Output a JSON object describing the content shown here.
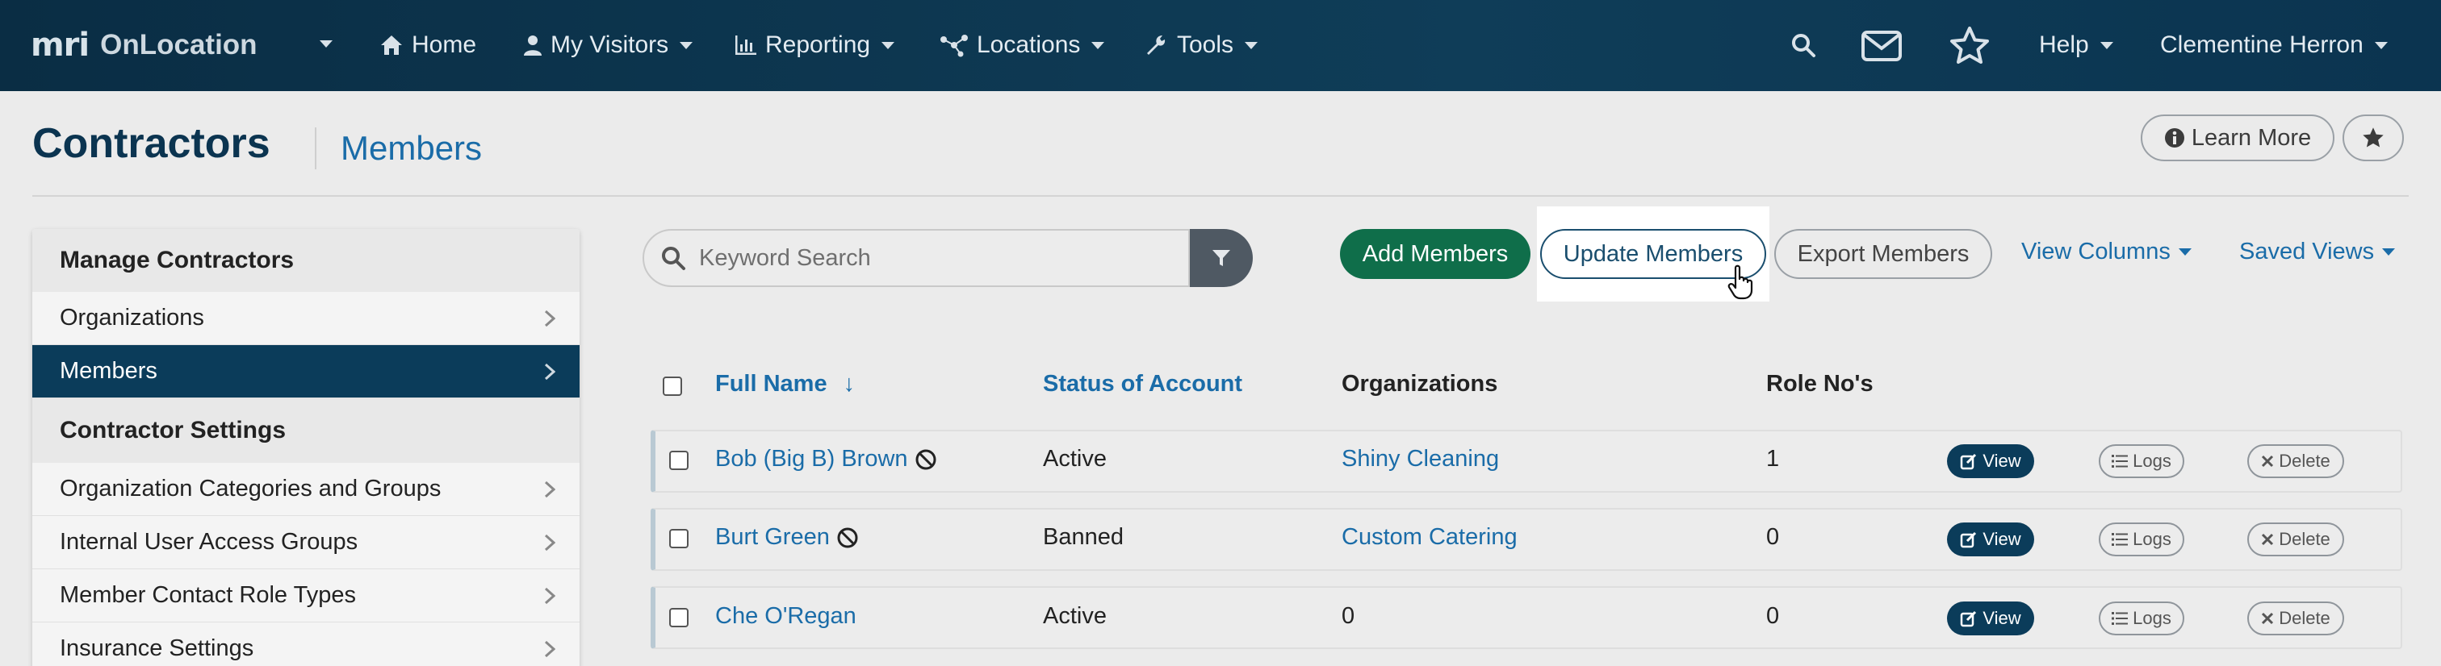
{
  "nav": {
    "brand_mark": "mri",
    "brand_app": "OnLocation",
    "home": "Home",
    "visitors": "My Visitors",
    "reporting": "Reporting",
    "locations": "Locations",
    "tools": "Tools",
    "help": "Help",
    "user": "Clementine Herron"
  },
  "header": {
    "title": "Contractors",
    "subtitle": "Members",
    "learn_more": "Learn More"
  },
  "sidebar": {
    "section1": "Manage Contractors",
    "items1": [
      {
        "label": "Organizations"
      },
      {
        "label": "Members",
        "active": true
      }
    ],
    "section2": "Contractor Settings",
    "items2": [
      {
        "label": "Organization Categories and Groups"
      },
      {
        "label": "Internal User Access Groups"
      },
      {
        "label": "Member Contact Role Types"
      },
      {
        "label": "Insurance Settings"
      }
    ]
  },
  "toolbar": {
    "search_placeholder": "Keyword Search",
    "add": "Add Members",
    "update": "Update Members",
    "export": "Export Members",
    "view_columns": "View Columns",
    "saved_views": "Saved Views"
  },
  "table": {
    "columns": {
      "full_name": "Full Name",
      "sort_arrow": "↓",
      "status": "Status of Account",
      "organizations": "Organizations",
      "roles": "Role No's"
    },
    "actions": {
      "view": "View",
      "logs": "Logs",
      "delete": "Delete"
    },
    "rows": [
      {
        "name": "Bob (Big B) Brown",
        "banned_icon": true,
        "status": "Active",
        "organization": "Shiny Cleaning",
        "org_is_link": true,
        "roles": "1"
      },
      {
        "name": "Burt Green",
        "banned_icon": true,
        "status": "Banned",
        "organization": "Custom Catering",
        "org_is_link": true,
        "roles": "0"
      },
      {
        "name": "Che O'Regan",
        "banned_icon": false,
        "status": "Active",
        "organization": "0",
        "org_is_link": false,
        "roles": "0"
      }
    ]
  },
  "colors": {
    "nav_bg": "#0b3450",
    "primary_dark": "#0b3c5a",
    "link": "#1a6ca8",
    "success": "#0f6e4a",
    "page_bg": "#ebebeb"
  }
}
